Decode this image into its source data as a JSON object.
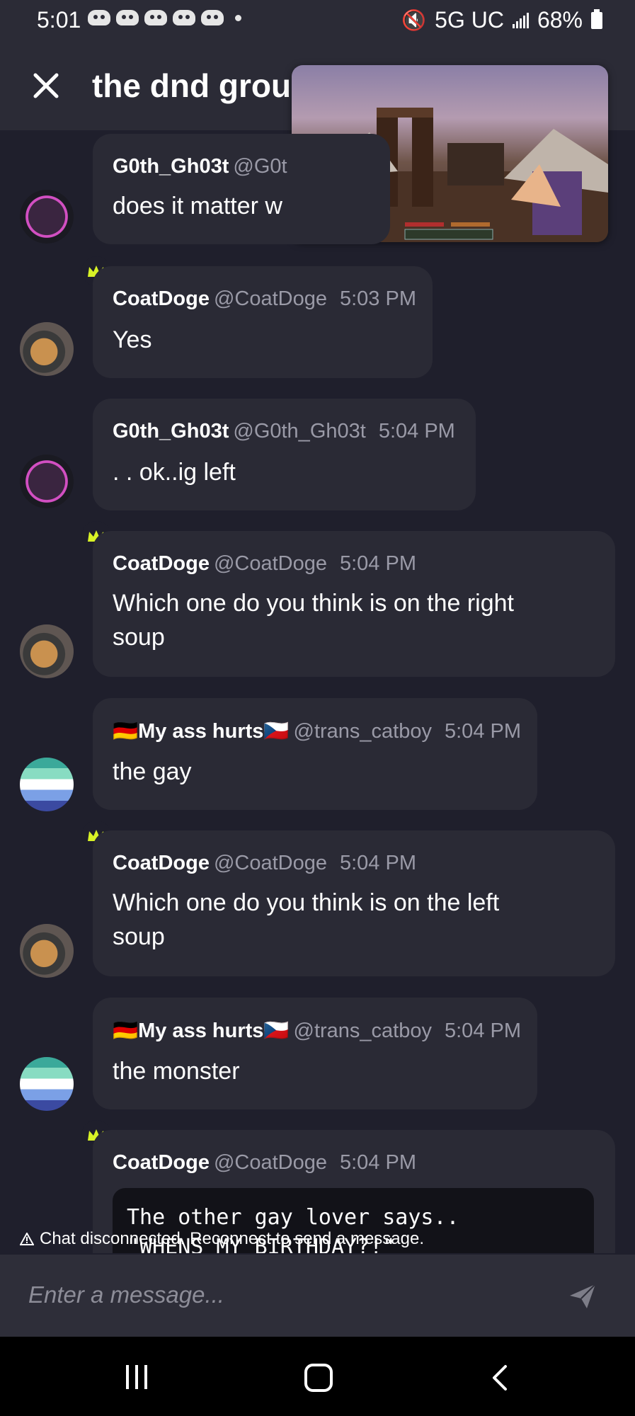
{
  "status": {
    "time": "5:01",
    "network": "5G UC",
    "battery": "68%"
  },
  "header": {
    "title": "the dnd group"
  },
  "messages": [
    {
      "name": "G0th_Gh03t",
      "handle": "@G0t",
      "time": "",
      "text": "does it matter w",
      "owner": false
    },
    {
      "name": "CoatDoge",
      "handle": "@CoatDoge",
      "time": "5:03 PM",
      "text": "Yes",
      "owner": true
    },
    {
      "name": "G0th_Gh03t",
      "handle": "@G0th_Gh03t",
      "time": "5:04 PM",
      "text": ". . ok..ig left",
      "owner": false
    },
    {
      "name": "CoatDoge",
      "handle": "@CoatDoge",
      "time": "5:04 PM",
      "text_line1": "Which one do you think is on the right",
      "text_line2": "soup",
      "owner": true
    },
    {
      "name": "🇩🇪My ass hurts🇨🇿",
      "handle": "@trans_catboy",
      "time": "5:04 PM",
      "text": "the gay",
      "owner": false
    },
    {
      "name": "CoatDoge",
      "handle": "@CoatDoge",
      "time": "5:04 PM",
      "text_line1": "Which one do you think is on the left",
      "text_line2": "soup",
      "owner": true
    },
    {
      "name": "🇩🇪My ass hurts🇨🇿",
      "handle": "@trans_catboy",
      "time": "5:04 PM",
      "text": "the monster",
      "owner": false
    },
    {
      "name": "CoatDoge",
      "handle": "@CoatDoge",
      "time": "5:04 PM",
      "code_line1": "The other gay lover says..",
      "code_line2": "\"WHENS MY BIRTHDAY?!\"",
      "owner": true
    }
  ],
  "banner": {
    "text": "Chat disconnected. Reconnect to send a message."
  },
  "composer": {
    "placeholder": "Enter a message..."
  },
  "colors": {
    "background": "#1f1f2c",
    "bubble": "#2a2a35",
    "crown": "#d8f226",
    "muted_text": "#9a9aa7"
  }
}
